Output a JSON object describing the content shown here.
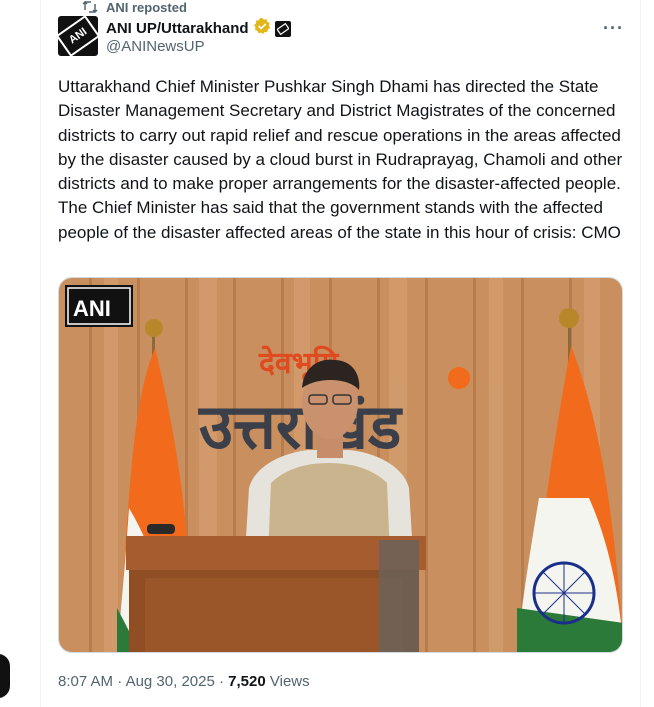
{
  "repost": {
    "label": "ANI reposted"
  },
  "author": {
    "display_name": "ANI UP/Uttarakhand",
    "handle": "@ANINewsUP",
    "avatar_text": "ANI"
  },
  "tweet": {
    "text": "Uttarakhand Chief Minister Pushkar Singh Dhami has directed the State Disaster Management Secretary and District Magistrates of the concerned districts to carry out rapid relief and rescue operations in the areas affected by the disaster caused by a cloud burst in Rudraprayag, Chamoli and other districts and to make proper arrangements for the disaster-affected people. The Chief Minister has said that the government stands with the affected people of the disaster affected areas of the state in this hour of crisis: CMO"
  },
  "media": {
    "watermark": "ANI",
    "sign_top": "देवभूमि",
    "sign_main": "उत्तराखंड"
  },
  "meta": {
    "time": "8:07 AM",
    "separator": "·",
    "date": "Aug 30, 2025",
    "views_count": "7,520",
    "views_label": "Views"
  },
  "colors": {
    "verified": "#e2b719",
    "secondary_text": "#536471",
    "wood": "#c98f5e"
  },
  "icons": {
    "repost": "repost-icon",
    "verified": "verified-badge-icon",
    "government": "government-badge-icon",
    "more": "more-icon"
  }
}
